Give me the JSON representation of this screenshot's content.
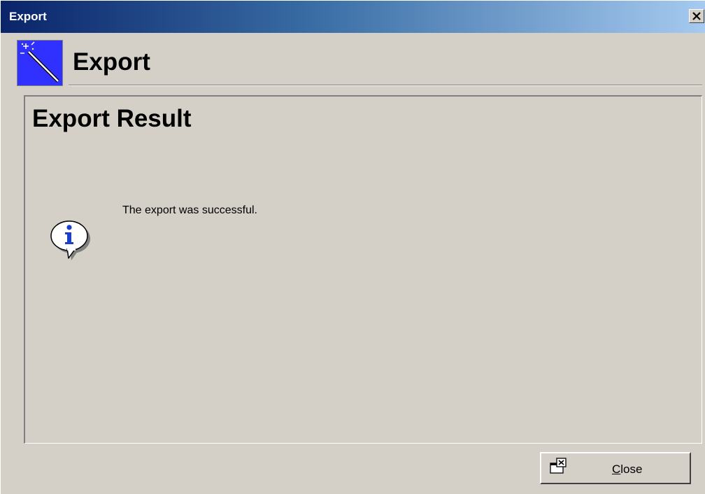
{
  "window": {
    "title": "Export",
    "close_glyph": "✕"
  },
  "header": {
    "title": "Export",
    "icon": "wizard-wand-icon"
  },
  "panel": {
    "title": "Export Result",
    "message": "The export was successful.",
    "icon": "info-icon"
  },
  "footer": {
    "close_label_mnemonic": "C",
    "close_label_rest": "lose",
    "close_icon": "close-window-icon"
  },
  "colors": {
    "titlebar_start": "#0a246a",
    "titlebar_end": "#a6caf0",
    "face": "#d4d0c8",
    "wizard_icon_bg": "#3030ff",
    "info_icon_text": "#1a3fc9"
  }
}
